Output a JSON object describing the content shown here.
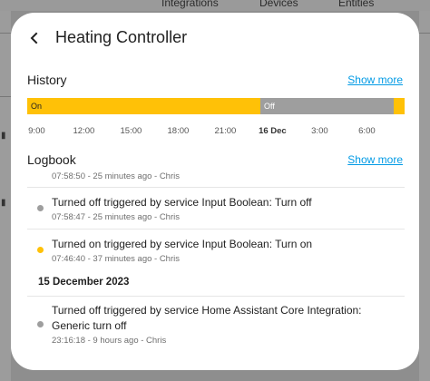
{
  "background": {
    "tabs": [
      "Integrations",
      "Devices",
      "Entities"
    ]
  },
  "dialog": {
    "title": "Heating Controller",
    "history": {
      "label": "History",
      "show_more": "Show more",
      "timeline": [
        {
          "state": "On",
          "start": 0.0,
          "end": 0.618
        },
        {
          "state": "Off",
          "start": 0.618,
          "end": 0.972
        },
        {
          "state": "",
          "start": 0.972,
          "end": 1.0
        }
      ],
      "state_colors": {
        "On": "#ffc107",
        "Off": "#9e9e9e"
      },
      "ticks": [
        {
          "label": "9:00",
          "pos": 0.025,
          "bold": false
        },
        {
          "label": "12:00",
          "pos": 0.15,
          "bold": false
        },
        {
          "label": "15:00",
          "pos": 0.275,
          "bold": false
        },
        {
          "label": "18:00",
          "pos": 0.4,
          "bold": false
        },
        {
          "label": "21:00",
          "pos": 0.525,
          "bold": false
        },
        {
          "label": "16 Dec",
          "pos": 0.65,
          "bold": true
        },
        {
          "label": "3:00",
          "pos": 0.775,
          "bold": false
        },
        {
          "label": "6:00",
          "pos": 0.9,
          "bold": false
        }
      ]
    },
    "logbook": {
      "label": "Logbook",
      "show_more": "Show more",
      "partial_meta": "07:58:50 - 25 minutes ago - Chris",
      "entries": [
        {
          "text": "Turned off triggered by service Input Boolean: Turn off",
          "meta": "07:58:47 - 25 minutes ago - Chris",
          "state": "off"
        },
        {
          "text": "Turned on triggered by service Input Boolean: Turn on",
          "meta": "07:46:40 - 37 minutes ago - Chris",
          "state": "on"
        }
      ],
      "date_heading": "15 December 2023",
      "entries2": [
        {
          "text_line1": "Turned off triggered by service Home Assistant Core Integration:",
          "text_line2": "Generic turn off",
          "meta": "23:16:18 - 9 hours ago - Chris",
          "state": "off"
        }
      ]
    },
    "dot_colors": {
      "on": "#ffc107",
      "off": "#9e9e9e"
    }
  }
}
